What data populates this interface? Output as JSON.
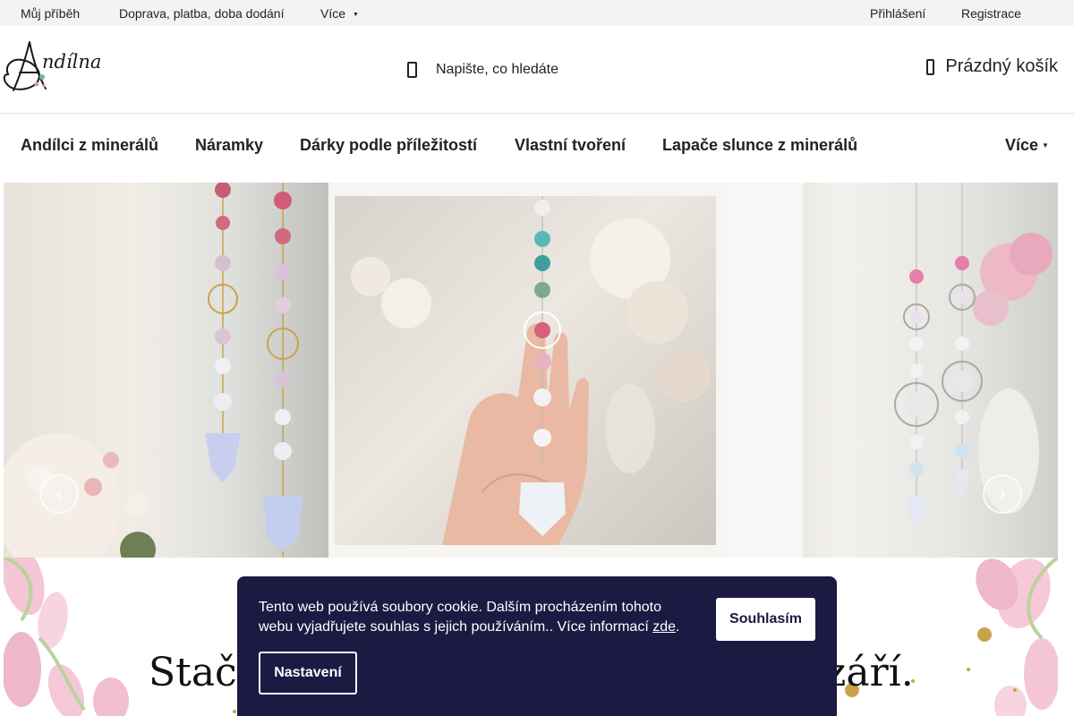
{
  "topbar": {
    "story": "Můj příběh",
    "shipping": "Doprava, platba, doba dodání",
    "more": "Více",
    "login": "Přihlášení",
    "register": "Registrace"
  },
  "header": {
    "logo_text": "Andílna",
    "search_placeholder": "Napište, co hledáte",
    "cart": "Prázdný košík"
  },
  "nav": {
    "items": [
      {
        "label": "Andílci z minerálů"
      },
      {
        "label": "Náramky"
      },
      {
        "label": "Dárky podle příležitostí"
      },
      {
        "label": "Vlastní tvoření"
      },
      {
        "label": "Lapače slunce z minerálů"
      }
    ],
    "more": "Více"
  },
  "banner": {
    "prev_icon": "chevron-left-icon",
    "next_icon": "chevron-right-icon"
  },
  "headline": {
    "left": "Stačí",
    "right": "zzáří."
  },
  "cookie": {
    "text": "Tento web používá soubory cookie. Dalším procházením tohoto webu vyjadřujete souhlas s jejich používáním.. Více informací ",
    "link": "zde",
    "accept": "Souhlasím",
    "settings": "Nastavení"
  },
  "colors": {
    "cookie_bg": "#1c1a42",
    "topbar_bg": "#f3f3f3",
    "accent_teal": "#6fb3b2",
    "accent_pink": "#d79ab3",
    "gold": "#c9a24c"
  }
}
